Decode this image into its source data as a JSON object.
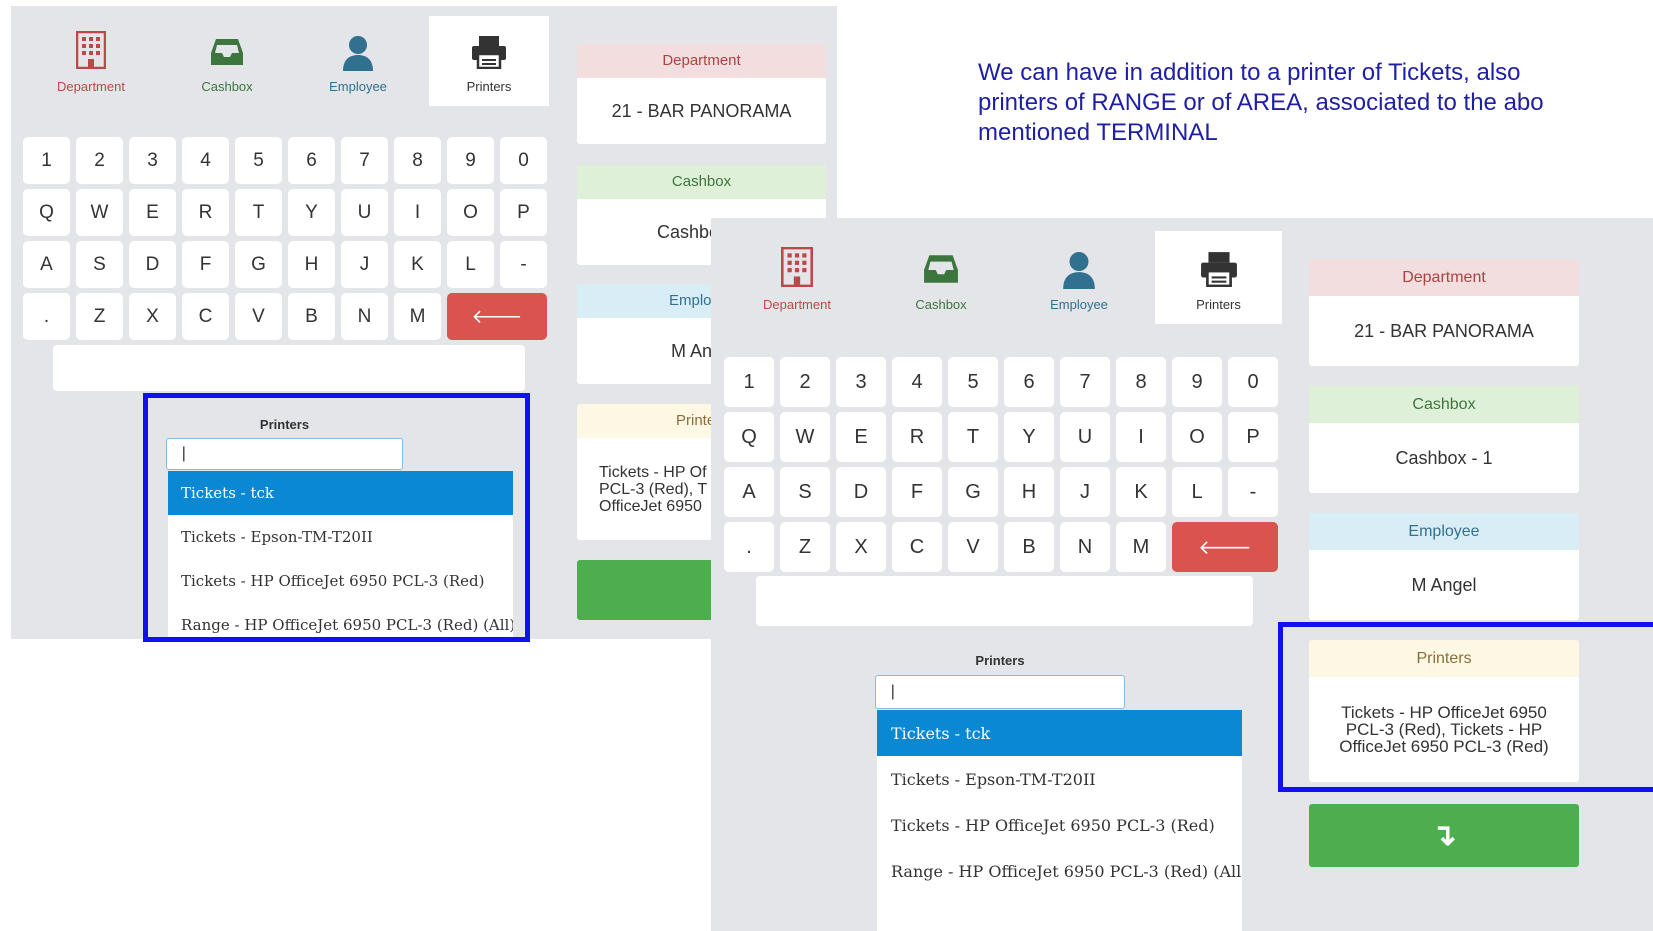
{
  "note": {
    "line1": "We can have in addition to a printer of Tickets, also",
    "line2": "printers of RANGE or of AREA, associated to the abo",
    "line3": "mentioned TERMINAL"
  },
  "colors": {
    "department": "#b94a48",
    "cashbox": "#3c763d",
    "employee": "#31708f",
    "printers": "#333333",
    "selected": "#0a88d3",
    "backspace": "#d9534f",
    "confirm": "#4cae4c",
    "highlight": "#1010f0"
  },
  "tabs": [
    {
      "label": "Department",
      "icon": "building-icon"
    },
    {
      "label": "Cashbox",
      "icon": "inbox-tray-icon"
    },
    {
      "label": "Employee",
      "icon": "user-icon"
    },
    {
      "label": "Printers",
      "icon": "printer-icon"
    }
  ],
  "keyboard": {
    "row1": [
      "1",
      "2",
      "3",
      "4",
      "5",
      "6",
      "7",
      "8",
      "9",
      "0"
    ],
    "row2": [
      "Q",
      "W",
      "E",
      "R",
      "T",
      "Y",
      "U",
      "I",
      "O",
      "P"
    ],
    "row3": [
      "A",
      "S",
      "D",
      "F",
      "G",
      "H",
      "J",
      "K",
      "L",
      "-"
    ],
    "row4": [
      ".",
      "Z",
      "X",
      "C",
      "V",
      "B",
      "N",
      "M"
    ],
    "backspace": "🡐"
  },
  "printers_popup": {
    "title": "Printers",
    "search_value": "|",
    "items": [
      "Tickets - tck",
      "Tickets - Epson-TM-T20II",
      "Tickets - HP OfficeJet 6950 PCL-3 (Red)",
      "Range - HP OfficeJet 6950 PCL-3 (Red) (All)"
    ]
  },
  "screen1": {
    "department": {
      "header": "Department",
      "value": "21 - BAR PANORAMA"
    },
    "cashbox": {
      "header": "Cashbox",
      "value": "Cashbo"
    },
    "employee": {
      "header": "Emplo",
      "value": "M An"
    },
    "printers": {
      "header": "Printe",
      "value": "Tickets - HP Of PCL-3 (Red), T OfficeJet 6950"
    },
    "confirm": "↴"
  },
  "screen2": {
    "department": {
      "header": "Department",
      "value": "21 - BAR PANORAMA"
    },
    "cashbox": {
      "header": "Cashbox",
      "value": "Cashbox - 1"
    },
    "employee": {
      "header": "Employee",
      "value": "M Angel"
    },
    "printers": {
      "header": "Printers",
      "value": "Tickets - HP OfficeJet 6950 PCL-3 (Red), Tickets - HP OfficeJet 6950 PCL-3 (Red)"
    },
    "confirm": "↴"
  }
}
